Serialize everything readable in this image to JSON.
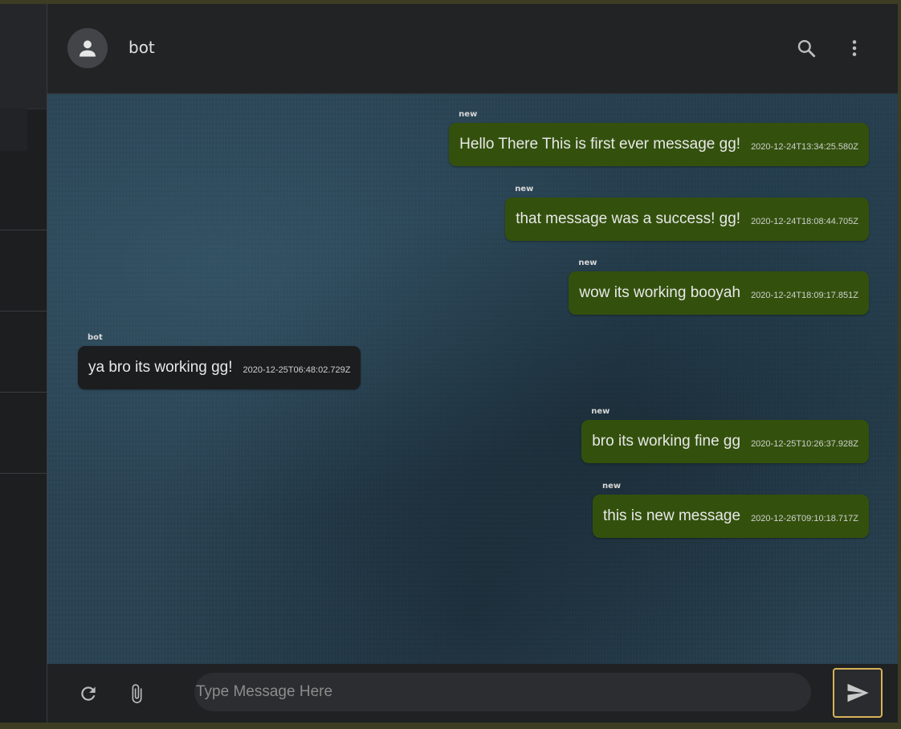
{
  "header": {
    "contact_name": "bot",
    "avatar_icon": "person-icon",
    "search_icon": "search-icon",
    "menu_icon": "more-vert-icon"
  },
  "messages": [
    {
      "sender": "new",
      "text": "Hello There This is first ever message gg!",
      "time": "2020-12-24T13:34:25.580Z",
      "direction": "out"
    },
    {
      "sender": "new",
      "text": "that message was a success! gg!",
      "time": "2020-12-24T18:08:44.705Z",
      "direction": "out"
    },
    {
      "sender": "new",
      "text": "wow its working booyah",
      "time": "2020-12-24T18:09:17.851Z",
      "direction": "out"
    },
    {
      "sender": "bot",
      "text": "ya bro its working gg!",
      "time": "2020-12-25T06:48:02.729Z",
      "direction": "in"
    },
    {
      "sender": "new",
      "text": "bro its working fine gg",
      "time": "2020-12-25T10:26:37.928Z",
      "direction": "out"
    },
    {
      "sender": "new",
      "text": "this is new message",
      "time": "2020-12-26T09:10:18.717Z",
      "direction": "out"
    }
  ],
  "footer": {
    "placeholder": "Type Message Here",
    "value": "",
    "refresh_icon": "refresh-icon",
    "attach_icon": "paperclip-icon",
    "send_icon": "send-icon"
  },
  "colors": {
    "outgoing_bubble": "#33510d",
    "incoming_bubble": "#1c1d1f",
    "send_border": "#d8b259"
  }
}
